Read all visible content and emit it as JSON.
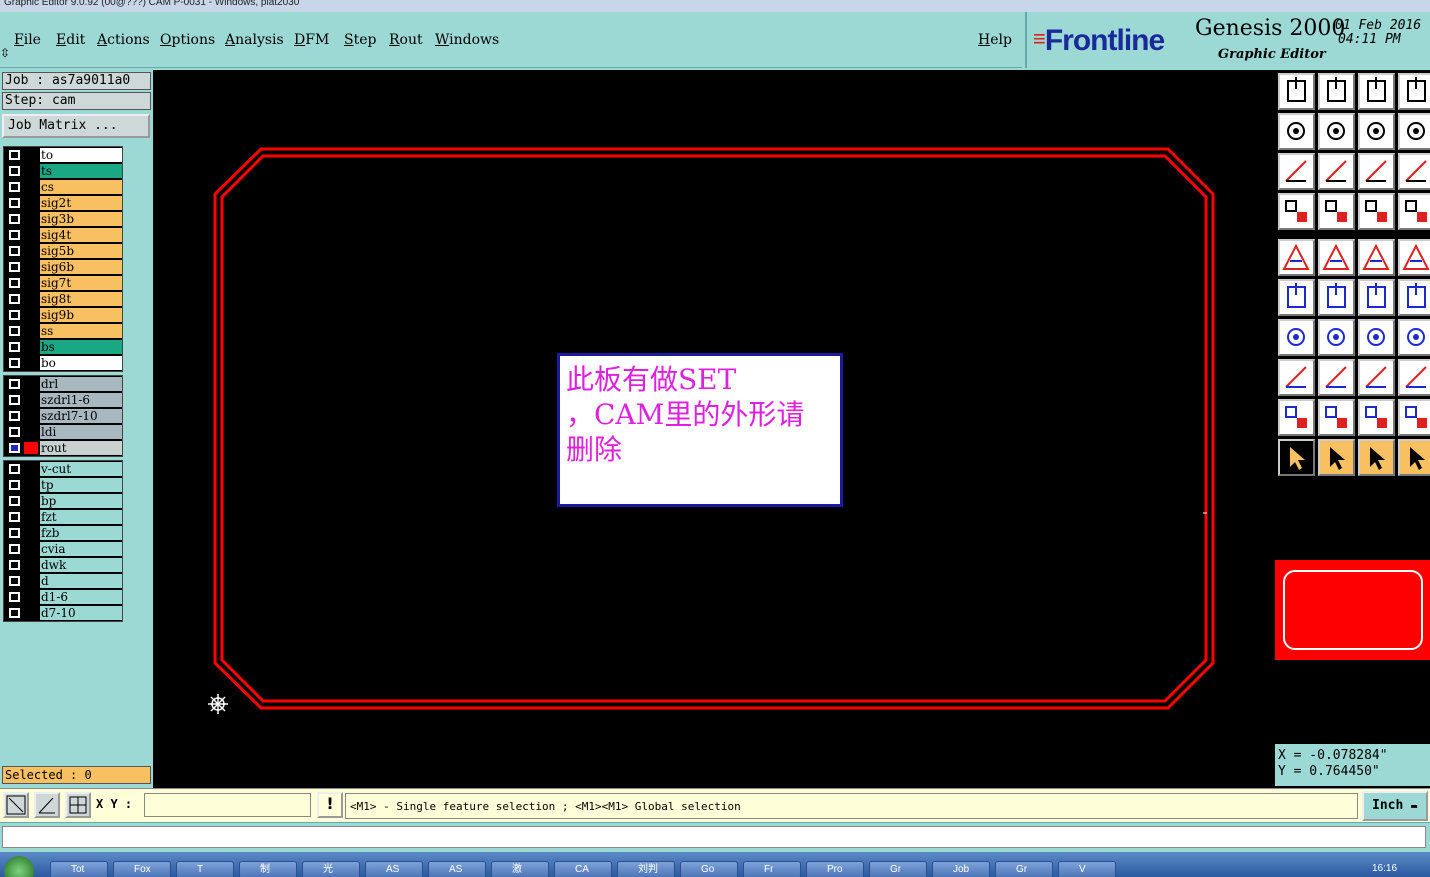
{
  "window_title": "Graphic Editor 9.0.92 (00@???) CAM P-0031 - Windows, plat2030",
  "menu": [
    "File",
    "Edit",
    "Actions",
    "Options",
    "Analysis",
    "DFM",
    "Step",
    "Rout",
    "Windows"
  ],
  "help": "Help",
  "brand": {
    "logo": "Frontline",
    "product": "Genesis 2000",
    "subtitle": "Graphic Editor",
    "date": "01 Feb 2016",
    "time": "04:11 PM"
  },
  "job": {
    "job_label": "Job : as7a9011a0",
    "step_label": "Step: cam",
    "matrix_button": "Job Matrix ..."
  },
  "layers_group1": [
    {
      "name": "to",
      "color": "#ffffff"
    },
    {
      "name": "ts",
      "color": "#1aa884"
    },
    {
      "name": "cs",
      "color": "#f8c060"
    },
    {
      "name": "sig2t",
      "color": "#f8c060"
    },
    {
      "name": "sig3b",
      "color": "#f8c060"
    },
    {
      "name": "sig4t",
      "color": "#f8c060"
    },
    {
      "name": "sig5b",
      "color": "#f8c060"
    },
    {
      "name": "sig6b",
      "color": "#f8c060"
    },
    {
      "name": "sig7t",
      "color": "#f8c060"
    },
    {
      "name": "sig8t",
      "color": "#f8c060"
    },
    {
      "name": "sig9b",
      "color": "#f8c060"
    },
    {
      "name": "ss",
      "color": "#f8c060"
    },
    {
      "name": "bs",
      "color": "#1aa884"
    },
    {
      "name": "bo",
      "color": "#ffffff"
    }
  ],
  "layers_group2": [
    {
      "name": "drl",
      "color": "#a8b8c0"
    },
    {
      "name": "szdrl1-6",
      "color": "#a8b8c0"
    },
    {
      "name": "szdrl7-10",
      "color": "#a8b8c0"
    },
    {
      "name": "ldi",
      "color": "#a8b8c0"
    },
    {
      "name": "rout",
      "color": "#c8d0d0",
      "active": true
    }
  ],
  "layers_group3": [
    {
      "name": "v-cut",
      "color": "#9cd9d5"
    },
    {
      "name": "tp",
      "color": "#9cd9d5"
    },
    {
      "name": "bp",
      "color": "#9cd9d5"
    },
    {
      "name": "fzt",
      "color": "#9cd9d5"
    },
    {
      "name": "fzb",
      "color": "#9cd9d5"
    },
    {
      "name": "cvia",
      "color": "#9cd9d5"
    },
    {
      "name": "dwk",
      "color": "#9cd9d5"
    },
    {
      "name": "d",
      "color": "#9cd9d5"
    },
    {
      "name": "d1-6",
      "color": "#9cd9d5"
    },
    {
      "name": "d7-10",
      "color": "#9cd9d5"
    }
  ],
  "note": {
    "line1": "此板有做SET",
    "line2": "，CAM里的外形请",
    "line3": "删除"
  },
  "selected": "Selected : 0",
  "coords": {
    "x": "X = -0.078284\"",
    "y": "Y = 0.764450\""
  },
  "status": {
    "xy_label": "X Y :",
    "xy_value": "",
    "hint": "<M1> - Single feature selection ; <M1><M1> Global selection",
    "units": "Inch"
  },
  "taskbar": [
    "Tot",
    "Fox",
    "T",
    "制",
    "光",
    "AS",
    "AS",
    "激",
    "CA",
    "刘判",
    "Go",
    "Fr",
    "Pro",
    "Gr",
    "Job",
    "Gr",
    "V"
  ],
  "clock": "16:16",
  "colors": {
    "rout": "#ff0000",
    "accent": "#9cd9d5",
    "note_text": "#e020e0"
  }
}
